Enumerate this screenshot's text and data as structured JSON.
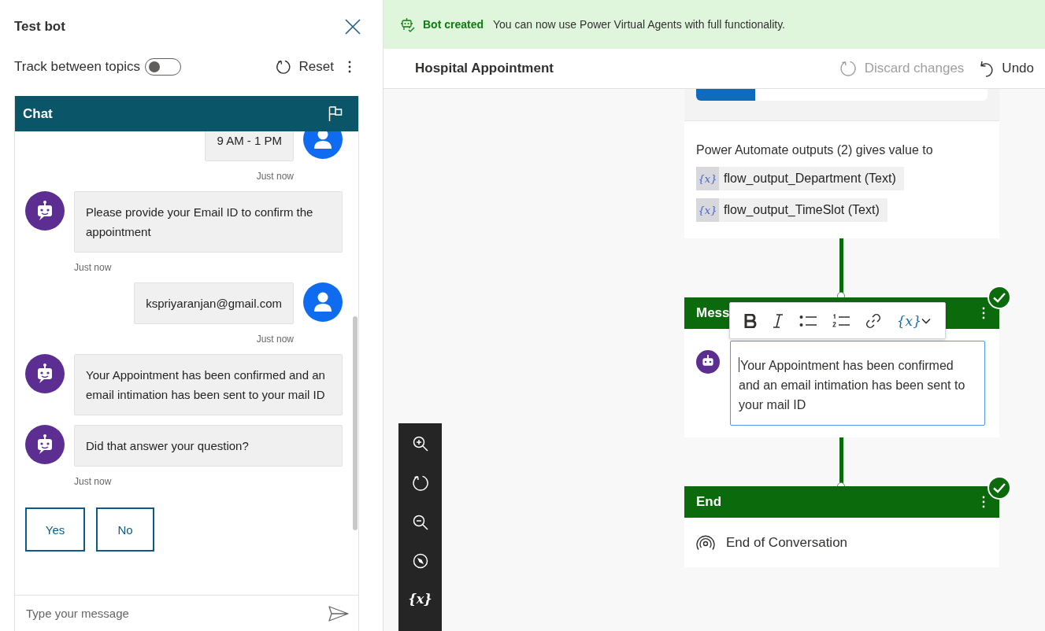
{
  "test_panel": {
    "title": "Test bot",
    "toggle": {
      "label": "Track between topics",
      "on": false
    },
    "reset": "Reset"
  },
  "chat": {
    "title": "Chat",
    "messages": [
      {
        "kind": "user",
        "text": "9 AM - 1 PM",
        "time": "Just now"
      },
      {
        "kind": "bot",
        "text": "Please provide your Email ID to confirm the appointment",
        "time": "Just now"
      },
      {
        "kind": "user",
        "text": "kspriyaranjan@gmail.com",
        "time": "Just now"
      },
      {
        "kind": "bot",
        "text": "Your Appointment has been confirmed and an email intimation has been sent to your mail ID"
      },
      {
        "kind": "bot",
        "text": "Did that answer your question?",
        "time": "Just now"
      }
    ],
    "suggested_actions": [
      "Yes",
      "No"
    ],
    "input": {
      "placeholder": "Type your message"
    }
  },
  "banner": {
    "title": "Bot created",
    "message": "You can now use Power Virtual Agents with full functionality."
  },
  "editor": {
    "topic": "Hospital Appointment",
    "discard": {
      "label": "Discard changes",
      "disabled": true
    },
    "undo": "Undo"
  },
  "canvas": {
    "output_node": {
      "text": "Power Automate outputs (2) gives value to",
      "variables": [
        {
          "badge": "{x}",
          "name": "flow_output_Department (Text)"
        },
        {
          "badge": "{x}",
          "name": "flow_output_TimeSlot (Text)"
        }
      ]
    },
    "message_node": {
      "title": "Mess",
      "text": "Your Appointment has been confirmed and an email intimation has been sent to your mail ID",
      "valid": true,
      "format_toolbar": {
        "variable_button": "{x}"
      }
    },
    "end_node": {
      "title": "End",
      "action": "End of Conversation",
      "valid": true
    },
    "side_toolbar": {
      "variable_button": "{x}"
    }
  }
}
